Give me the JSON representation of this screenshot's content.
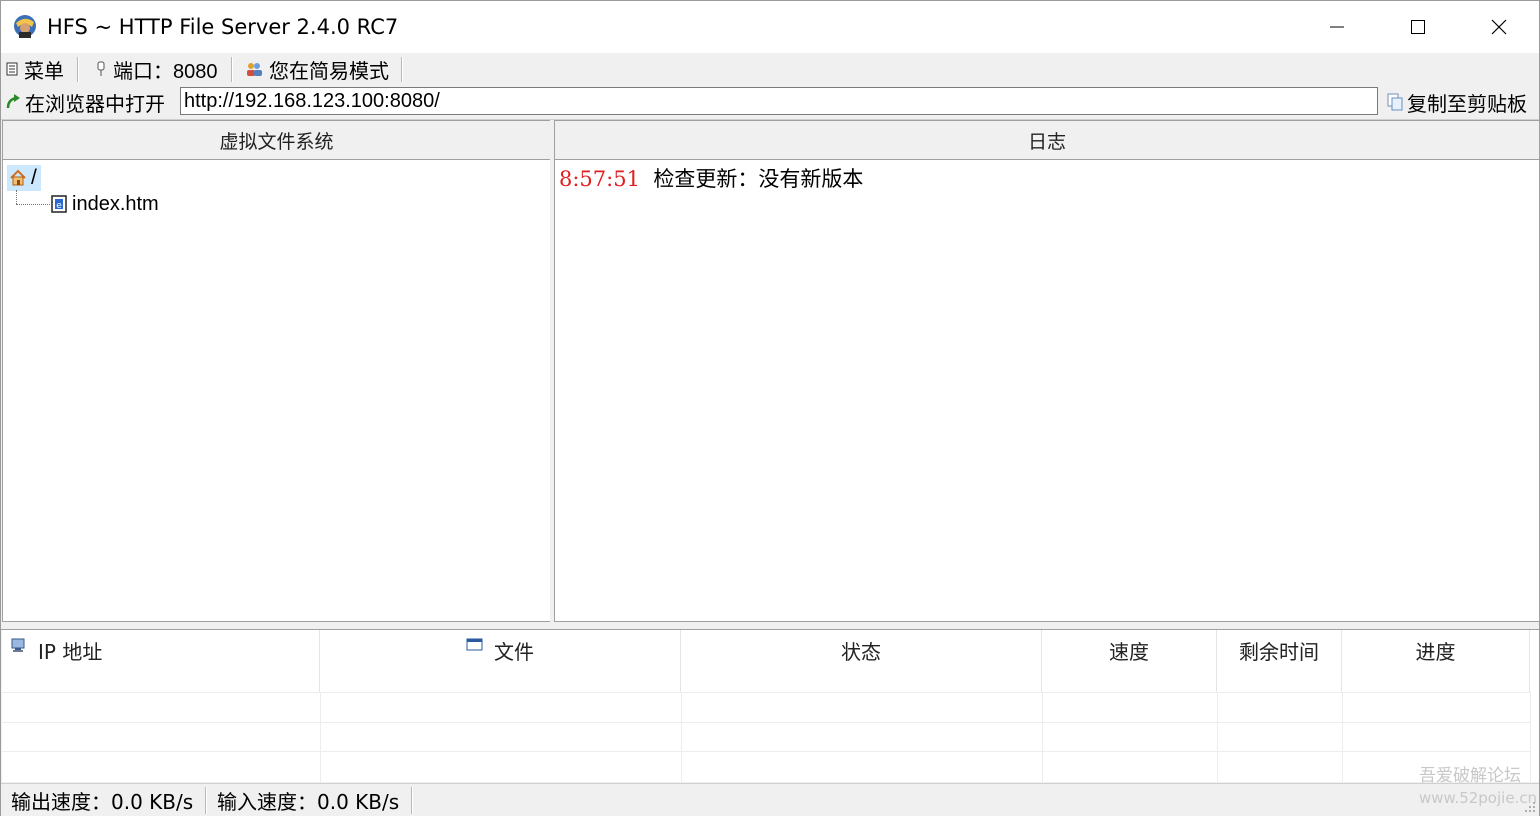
{
  "window": {
    "title": "HFS ~ HTTP File Server 2.4.0 RC7"
  },
  "toolbar": {
    "menu_label": "菜单",
    "port_label": "端口：",
    "port_value": "8080",
    "mode_label": "您在简易模式"
  },
  "urlbar": {
    "open_label": "在浏览器中打开",
    "url_value": "http://192.168.123.100:8080/",
    "copy_label": "复制至剪贴板"
  },
  "vfs": {
    "header": "虚拟文件系统",
    "root_label": "/",
    "items": [
      {
        "label": "index.htm"
      }
    ]
  },
  "log": {
    "header": "日志",
    "entries": [
      {
        "time": "8:57:51",
        "message": "检查更新：没有新版本"
      }
    ]
  },
  "connections": {
    "columns": [
      "IP 地址",
      "文件",
      "状态",
      "速度",
      "剩余时间",
      "进度"
    ]
  },
  "statusbar": {
    "out_speed": "输出速度：0.0 KB/s",
    "in_speed": "输入速度：0.0 KB/s"
  },
  "watermark": {
    "line1": "吾爱破解论坛",
    "line2": "www.52pojie.cn"
  },
  "colors": {
    "log_time": "#e02020",
    "tree_selection": "#cce8ff"
  }
}
